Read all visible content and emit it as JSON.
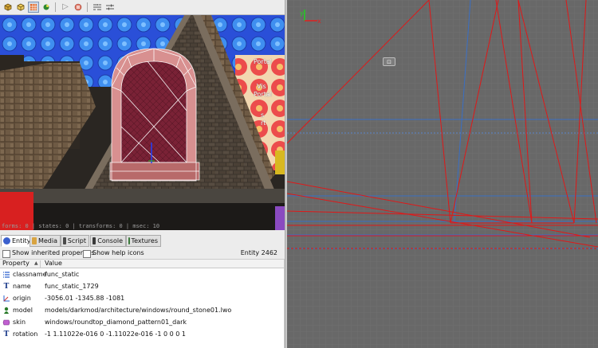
{
  "camera": {
    "toolbar_icons": [
      "cube-solid-icon",
      "cube-wire-icon",
      "render-mode-icon",
      "lighting-icon",
      "play-icon",
      "stop-icon",
      "filter-icon",
      "far-clip-icon"
    ],
    "stats_text": "forms: 0 | states: 0 | transforms: 0 | msec: 10",
    "portal_labels": [
      "Portal",
      "Vis",
      "Portal",
      "s",
      "rt"
    ]
  },
  "tabs": [
    {
      "label": "Entity",
      "icon": "entity-icon",
      "active": true,
      "color": "#3a5fcd"
    },
    {
      "label": "Media",
      "icon": "folder-icon",
      "active": false,
      "color": "#d9a441"
    },
    {
      "label": "Script",
      "icon": "script-icon",
      "active": false,
      "color": "#4a4a4a"
    },
    {
      "label": "Console",
      "icon": "console-icon",
      "active": false,
      "color": "#3a3a3a"
    },
    {
      "label": "Textures",
      "icon": "textures-icon",
      "active": false,
      "color": "#3b7a3b"
    }
  ],
  "options": {
    "show_inherited": "Show inherited properties",
    "show_help": "Show help icons",
    "entity_count": "Entity 2462"
  },
  "table": {
    "col_property": "Property",
    "col_value": "Value",
    "rows": [
      {
        "icon": "classname-icon",
        "key": "classname",
        "value": "func_static"
      },
      {
        "icon": "text-icon",
        "key": "name",
        "value": "func_static_1729"
      },
      {
        "icon": "vector-icon",
        "key": "origin",
        "value": "-3056.01 -1345.88 -1081"
      },
      {
        "icon": "model-icon",
        "key": "model",
        "value": "models/darkmod/architecture/windows/round_stone01.lwo"
      },
      {
        "icon": "skin-icon",
        "key": "skin",
        "value": "windows/roundtop_diamond_pattern01_dark"
      },
      {
        "icon": "text-icon",
        "key": "rotation",
        "value": "-1 1.11022e-016 0 -1.11022e-016 -1 0 0 0 1"
      }
    ]
  },
  "ortho": {
    "axis_y": "y",
    "axis_x": "x",
    "colors": {
      "background": "#686868",
      "grid": "#787878",
      "selection": "#e01818",
      "blue_line": "#3a6fc4"
    }
  }
}
